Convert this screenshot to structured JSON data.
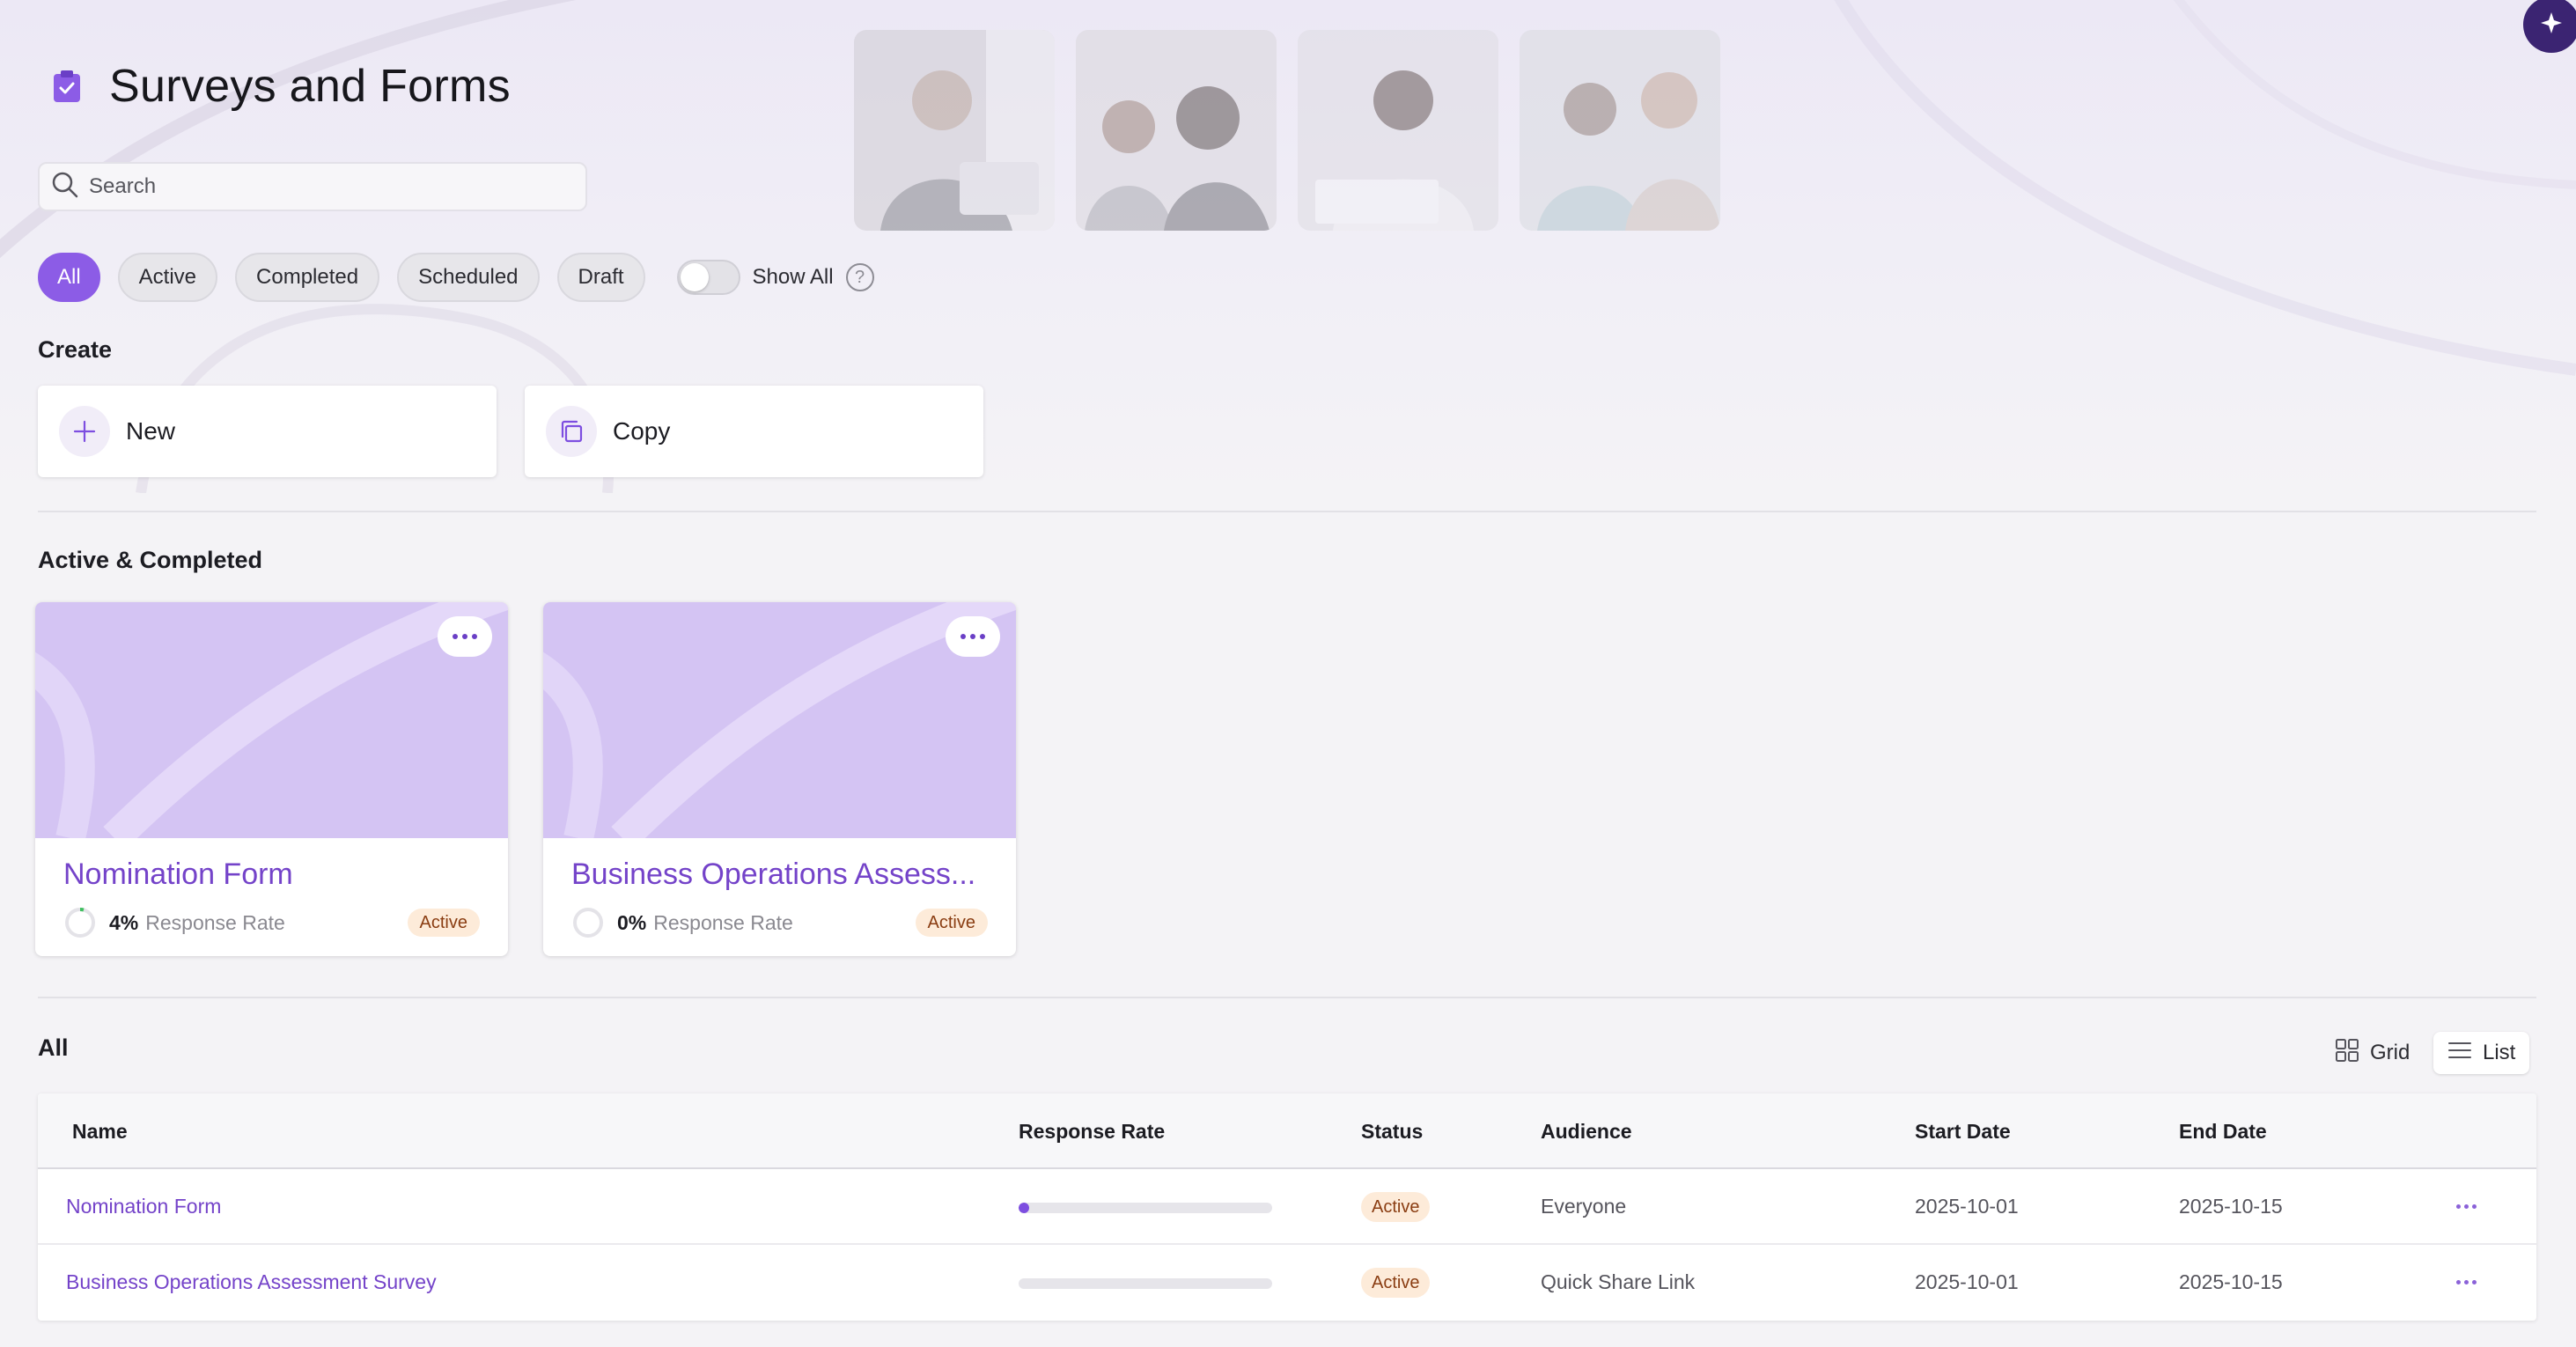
{
  "header": {
    "title": "Surveys and Forms",
    "title_icon": "clipboard-check-icon",
    "accent_color": "#8c5ce6"
  },
  "search": {
    "placeholder": "Search",
    "value": ""
  },
  "filters": {
    "pills": [
      "All",
      "Active",
      "Completed",
      "Scheduled",
      "Draft"
    ],
    "selected": "All",
    "show_all_label": "Show All",
    "show_all_enabled": false
  },
  "create": {
    "section_title": "Create",
    "new_label": "New",
    "copy_label": "Copy"
  },
  "active_completed": {
    "section_title": "Active & Completed",
    "cards": [
      {
        "title": "Nomination Form",
        "rate": "4%",
        "rate_label": "Response Rate",
        "status": "Active"
      },
      {
        "title": "Business Operations Assess...",
        "rate": "0%",
        "rate_label": "Response Rate",
        "status": "Active"
      }
    ]
  },
  "all": {
    "section_title": "All",
    "view_grid_label": "Grid",
    "view_list_label": "List",
    "selected_view": "List",
    "columns": [
      "Name",
      "Response Rate",
      "Status",
      "Audience",
      "Start Date",
      "End Date"
    ],
    "rows": [
      {
        "name": "Nomination Form",
        "response_rate": 0.04,
        "status": "Active",
        "audience": "Everyone",
        "start": "2025-10-01",
        "end": "2025-10-15"
      },
      {
        "name": "Business Operations Assessment Survey",
        "response_rate": 0.0,
        "status": "Active",
        "audience": "Quick Share Link",
        "start": "2025-10-01",
        "end": "2025-10-15"
      }
    ]
  }
}
